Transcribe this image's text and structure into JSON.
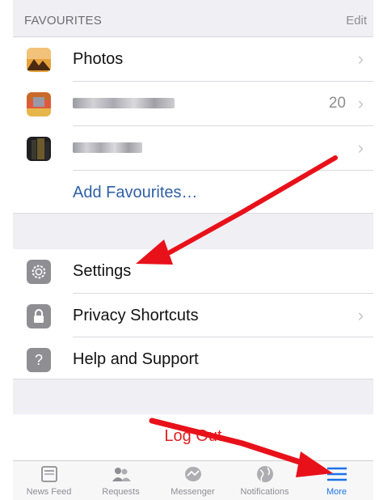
{
  "favourites": {
    "title": "FAVOURITES",
    "edit_label": "Edit",
    "items": [
      {
        "label": "Photos",
        "count": ""
      },
      {
        "label": "",
        "count": "20"
      },
      {
        "label": "",
        "count": ""
      }
    ],
    "add_label": "Add Favourites…"
  },
  "settings_section": {
    "items": [
      {
        "label": "Settings",
        "icon": "gear-icon"
      },
      {
        "label": "Privacy Shortcuts",
        "icon": "lock-icon"
      },
      {
        "label": "Help and Support",
        "icon": "question-icon"
      }
    ]
  },
  "logout_label": "Log Out",
  "tabbar": {
    "tabs": [
      {
        "label": "News Feed",
        "icon": "news-feed-icon",
        "active": false
      },
      {
        "label": "Requests",
        "icon": "friend-requests-icon",
        "active": false
      },
      {
        "label": "Messenger",
        "icon": "messenger-icon",
        "active": false
      },
      {
        "label": "Notifications",
        "icon": "globe-icon",
        "active": false
      },
      {
        "label": "More",
        "icon": "hamburger-menu-icon",
        "active": true
      }
    ]
  },
  "colors": {
    "link_blue": "#2f5fa7",
    "logout_red": "#e02020",
    "active_tab_blue": "#1a73e8",
    "annotation_arrow_red": "#e8111a"
  }
}
